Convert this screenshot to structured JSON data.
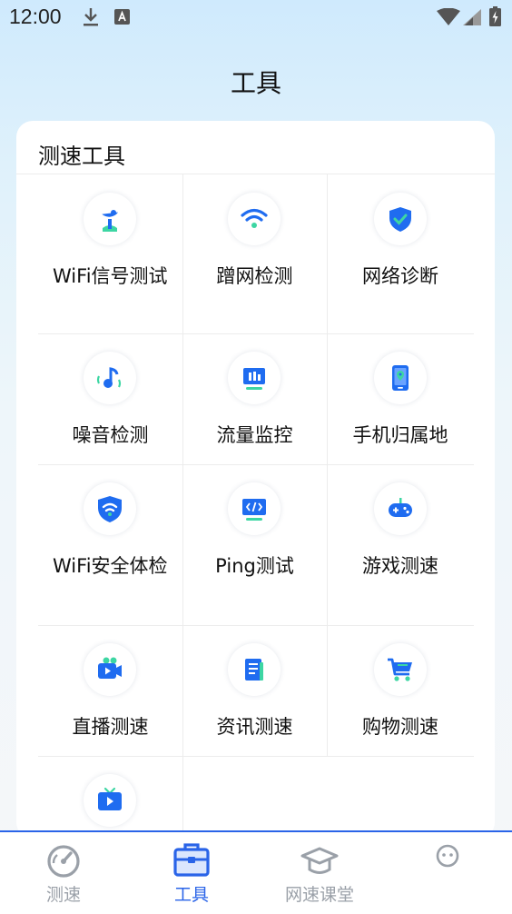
{
  "status_bar": {
    "time": "12:00"
  },
  "page_title": "工具",
  "section": {
    "title": "测速工具",
    "tools": [
      {
        "label": "WiFi信号测试",
        "icon": "satellite-dish-icon"
      },
      {
        "label": "蹭网检测",
        "icon": "wifi-icon"
      },
      {
        "label": "网络诊断",
        "icon": "shield-check-icon"
      },
      {
        "label": "噪音检测",
        "icon": "music-note-icon"
      },
      {
        "label": "流量监控",
        "icon": "bar-monitor-icon"
      },
      {
        "label": "手机归属地",
        "icon": "phone-location-icon"
      },
      {
        "label": "WiFi安全体检",
        "icon": "wifi-shield-icon"
      },
      {
        "label": "Ping测试",
        "icon": "code-monitor-icon"
      },
      {
        "label": "游戏测速",
        "icon": "gamepad-icon"
      },
      {
        "label": "直播测速",
        "icon": "video-camera-icon"
      },
      {
        "label": "资讯测速",
        "icon": "document-icon"
      },
      {
        "label": "购物测速",
        "icon": "shopping-cart-icon"
      },
      {
        "label": "",
        "icon": "tv-play-icon"
      }
    ]
  },
  "bottom_nav": {
    "items": [
      {
        "label": "测速",
        "icon": "speedometer-icon",
        "active": false
      },
      {
        "label": "工具",
        "icon": "toolbox-icon",
        "active": true
      },
      {
        "label": "网速课堂",
        "icon": "graduation-cap-icon",
        "active": false
      },
      {
        "label": "",
        "icon": "smiley-icon",
        "active": false
      }
    ]
  },
  "colors": {
    "accent": "#2a64e8",
    "icon_blue": "#1f6cf0",
    "icon_green": "#3dd6a3",
    "inactive": "#9aa0a8"
  }
}
